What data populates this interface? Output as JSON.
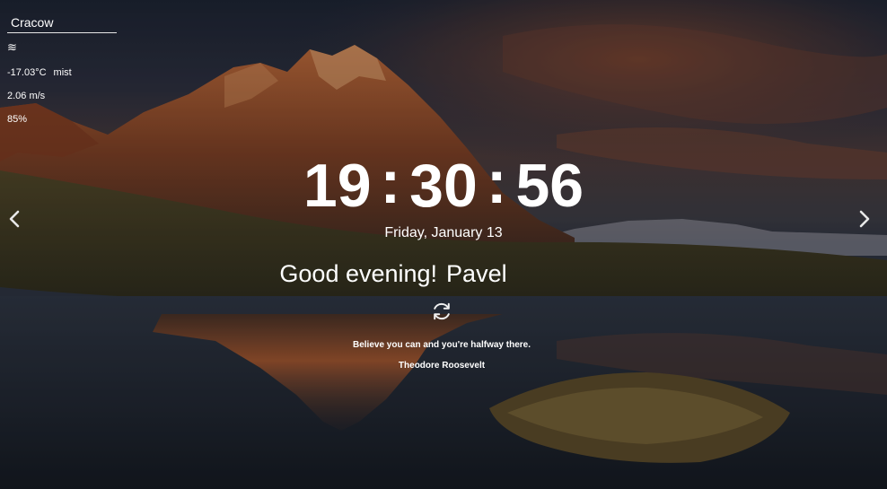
{
  "weather": {
    "city": "Cracow",
    "icon": "mist-icon",
    "icon_glyph": "≋",
    "temperature": "-17.03°C",
    "description": "mist",
    "wind": "2.06 m/s",
    "humidity": "85%"
  },
  "clock": {
    "hours": "19",
    "minutes": "30",
    "seconds": "56",
    "separator": ":"
  },
  "date": "Friday, January 13",
  "greeting": {
    "text": "Good evening!",
    "name": "Pavel"
  },
  "quote": {
    "text": "Believe you can and you're halfway there.",
    "author": "Theodore Roosevelt"
  },
  "colors": {
    "text": "#ffffff"
  }
}
